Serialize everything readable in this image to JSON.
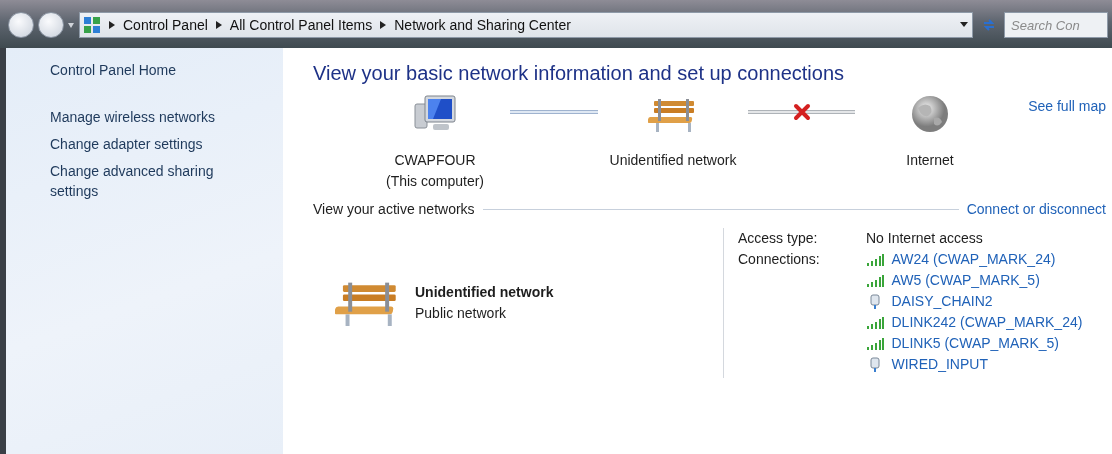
{
  "address_bar": {
    "breadcrumbs": [
      "Control Panel",
      "All Control Panel Items",
      "Network and Sharing Center"
    ]
  },
  "search": {
    "placeholder": "Search Con"
  },
  "sidebar": {
    "home": "Control Panel Home",
    "tasks": [
      "Manage wireless networks",
      "Change adapter settings",
      "Change advanced sharing settings"
    ]
  },
  "heading": "View your basic network information and set up connections",
  "map": {
    "nodes": [
      {
        "kind": "computer",
        "label": "CWAPFOUR",
        "sublabel": "(This computer)"
      },
      {
        "kind": "network",
        "label": "Unidentified network"
      },
      {
        "kind": "internet",
        "label": "Internet"
      }
    ],
    "links": [
      {
        "broken": false
      },
      {
        "broken": true
      }
    ],
    "see_full_map": "See full map"
  },
  "active_networks": {
    "title": "View your active networks",
    "action": "Connect or disconnect",
    "network": {
      "name": "Unidentified network",
      "type": "Public network"
    },
    "access_type_label": "Access type:",
    "access_type": "No Internet access",
    "connections_label": "Connections:",
    "connections": [
      {
        "kind": "wireless",
        "name": "AW24 (CWAP_MARK_24)"
      },
      {
        "kind": "wireless",
        "name": "AW5 (CWAP_MARK_5)"
      },
      {
        "kind": "wired",
        "name": "DAISY_CHAIN2"
      },
      {
        "kind": "wireless",
        "name": "DLINK242 (CWAP_MARK_24)"
      },
      {
        "kind": "wireless",
        "name": "DLINK5 (CWAP_MARK_5)"
      },
      {
        "kind": "wired",
        "name": "WIRED_INPUT"
      }
    ]
  }
}
